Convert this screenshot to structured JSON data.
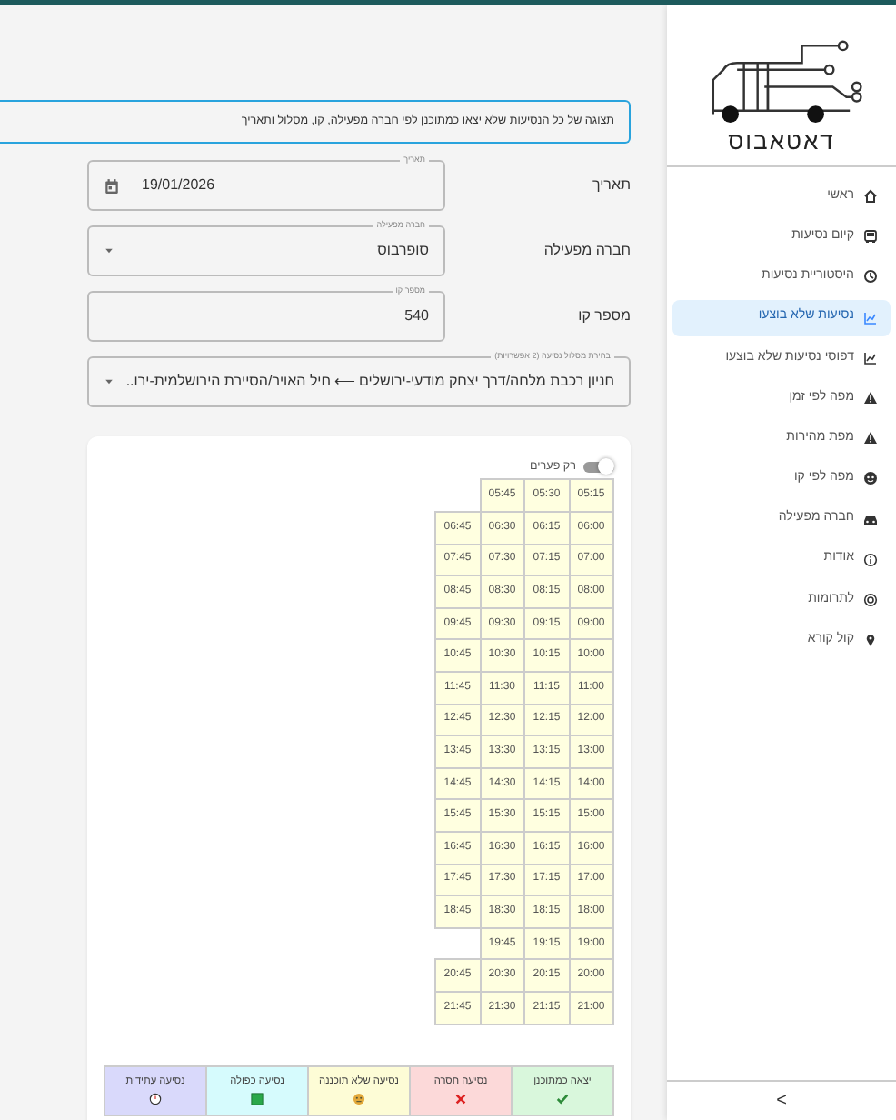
{
  "sidebar": {
    "logo_text": "דאטאבוס",
    "items": [
      {
        "label": "ראשי",
        "selected": false
      },
      {
        "label": "קיום נסיעות",
        "selected": false
      },
      {
        "label": "היסטוריית נסיעות",
        "selected": false
      },
      {
        "label": "נסיעות שלא בוצעו",
        "selected": true
      },
      {
        "label": "דפוסי נסיעות שלא בוצעו",
        "selected": false
      },
      {
        "label": "מפה לפי זמן",
        "selected": false
      },
      {
        "label": "מפת מהירות",
        "selected": false
      },
      {
        "label": "מפה לפי קו",
        "selected": false
      },
      {
        "label": "חברה מפעילה",
        "selected": false
      },
      {
        "label": "אודות",
        "selected": false
      },
      {
        "label": "לתרומות",
        "selected": false
      },
      {
        "label": "קול קורא",
        "selected": false
      }
    ],
    "collapse": ">"
  },
  "description": "תצוגה של כל הנסיעות שלא יצאו כמתוכנן לפי חברה מפעילה, קו, מסלול ותאריך",
  "fields": [
    {
      "label": "תאריך",
      "legend": "תאריך",
      "value": "19/01/2026",
      "kind": "date"
    },
    {
      "label": "חברה מפעילה",
      "legend": "חברה מפעילה",
      "value": "סופרבוס",
      "kind": "select"
    },
    {
      "label": "מספר קו",
      "legend": "מספר קו",
      "value": "540",
      "kind": "number"
    }
  ],
  "route": {
    "legend": "בחירת מסלול נסיעה (2 אפשרויות)",
    "value": "חניון רכבת מלחה/דרך יצחק מודעי-ירושלים ⟵ חיל האויר/הסיירת הירושלמית-ירו.."
  },
  "gaps_toggle": {
    "label": "רק פערים",
    "on": false
  },
  "timetable": [
    [
      "05:45",
      "05:30",
      "05:15"
    ],
    [
      "06:45",
      "06:30",
      "06:15",
      "06:00"
    ],
    [
      "07:45",
      "07:30",
      "07:15",
      "07:00"
    ],
    [
      "08:45",
      "08:30",
      "08:15",
      "08:00"
    ],
    [
      "09:45",
      "09:30",
      "09:15",
      "09:00"
    ],
    [
      "10:45",
      "10:30",
      "10:15",
      "10:00"
    ],
    [
      "11:45",
      "11:30",
      "11:15",
      "11:00"
    ],
    [
      "12:45",
      "12:30",
      "12:15",
      "12:00"
    ],
    [
      "13:45",
      "13:30",
      "13:15",
      "13:00"
    ],
    [
      "14:45",
      "14:30",
      "14:15",
      "14:00"
    ],
    [
      "15:45",
      "15:30",
      "15:15",
      "15:00"
    ],
    [
      "16:45",
      "16:30",
      "16:15",
      "16:00"
    ],
    [
      "17:45",
      "17:30",
      "17:15",
      "17:00"
    ],
    [
      "18:45",
      "18:30",
      "18:15",
      "18:00"
    ],
    [
      "19:45",
      "19:15",
      "19:00"
    ],
    [
      "20:45",
      "20:30",
      "20:15",
      "20:00"
    ],
    [
      "21:45",
      "21:30",
      "21:15",
      "21:00"
    ]
  ],
  "legend": [
    {
      "label": "יצאה כמתוכנן",
      "color": "#d9f7dc",
      "kind": "check"
    },
    {
      "label": "נסיעה חסרה",
      "color": "#fcd9d9",
      "kind": "cross"
    },
    {
      "label": "נסיעה שלא תוכננה",
      "color": "#fdfcd6",
      "kind": "face"
    },
    {
      "label": "נסיעה כפולה",
      "color": "#d6fbfd",
      "kind": "square"
    },
    {
      "label": "נסיעה עתידית",
      "color": "#d9d9fb",
      "kind": "clock"
    }
  ]
}
